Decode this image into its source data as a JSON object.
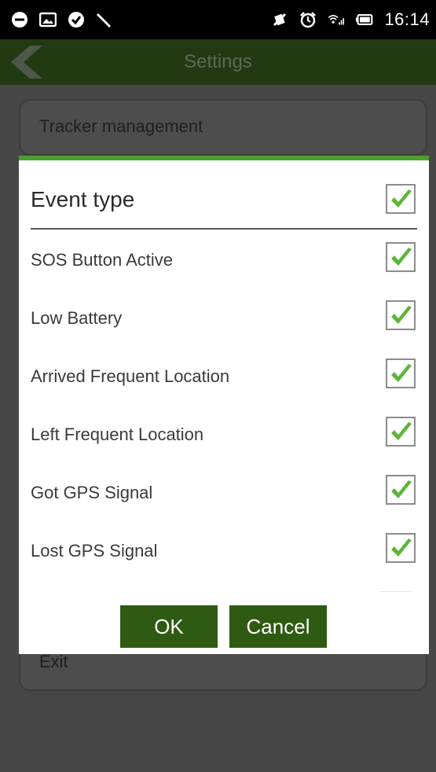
{
  "status_bar": {
    "time": "16:14"
  },
  "app_bar": {
    "title": "Settings"
  },
  "background": {
    "top_item": "Tracker management",
    "bottom_item": "Exit"
  },
  "dialog": {
    "title": "Event type",
    "select_all_checked": true,
    "items": [
      {
        "label": "SOS Button Active",
        "checked": true
      },
      {
        "label": "Low Battery",
        "checked": true
      },
      {
        "label": "Arrived Frequent Location",
        "checked": true
      },
      {
        "label": "Left Frequent Location",
        "checked": true
      },
      {
        "label": "Got GPS Signal",
        "checked": true
      },
      {
        "label": "Lost GPS Signal",
        "checked": true
      }
    ],
    "ok_label": "OK",
    "cancel_label": "Cancel"
  },
  "colors": {
    "accent": "#4aa12e",
    "button": "#2f5a12",
    "check": "#5cb53a"
  }
}
